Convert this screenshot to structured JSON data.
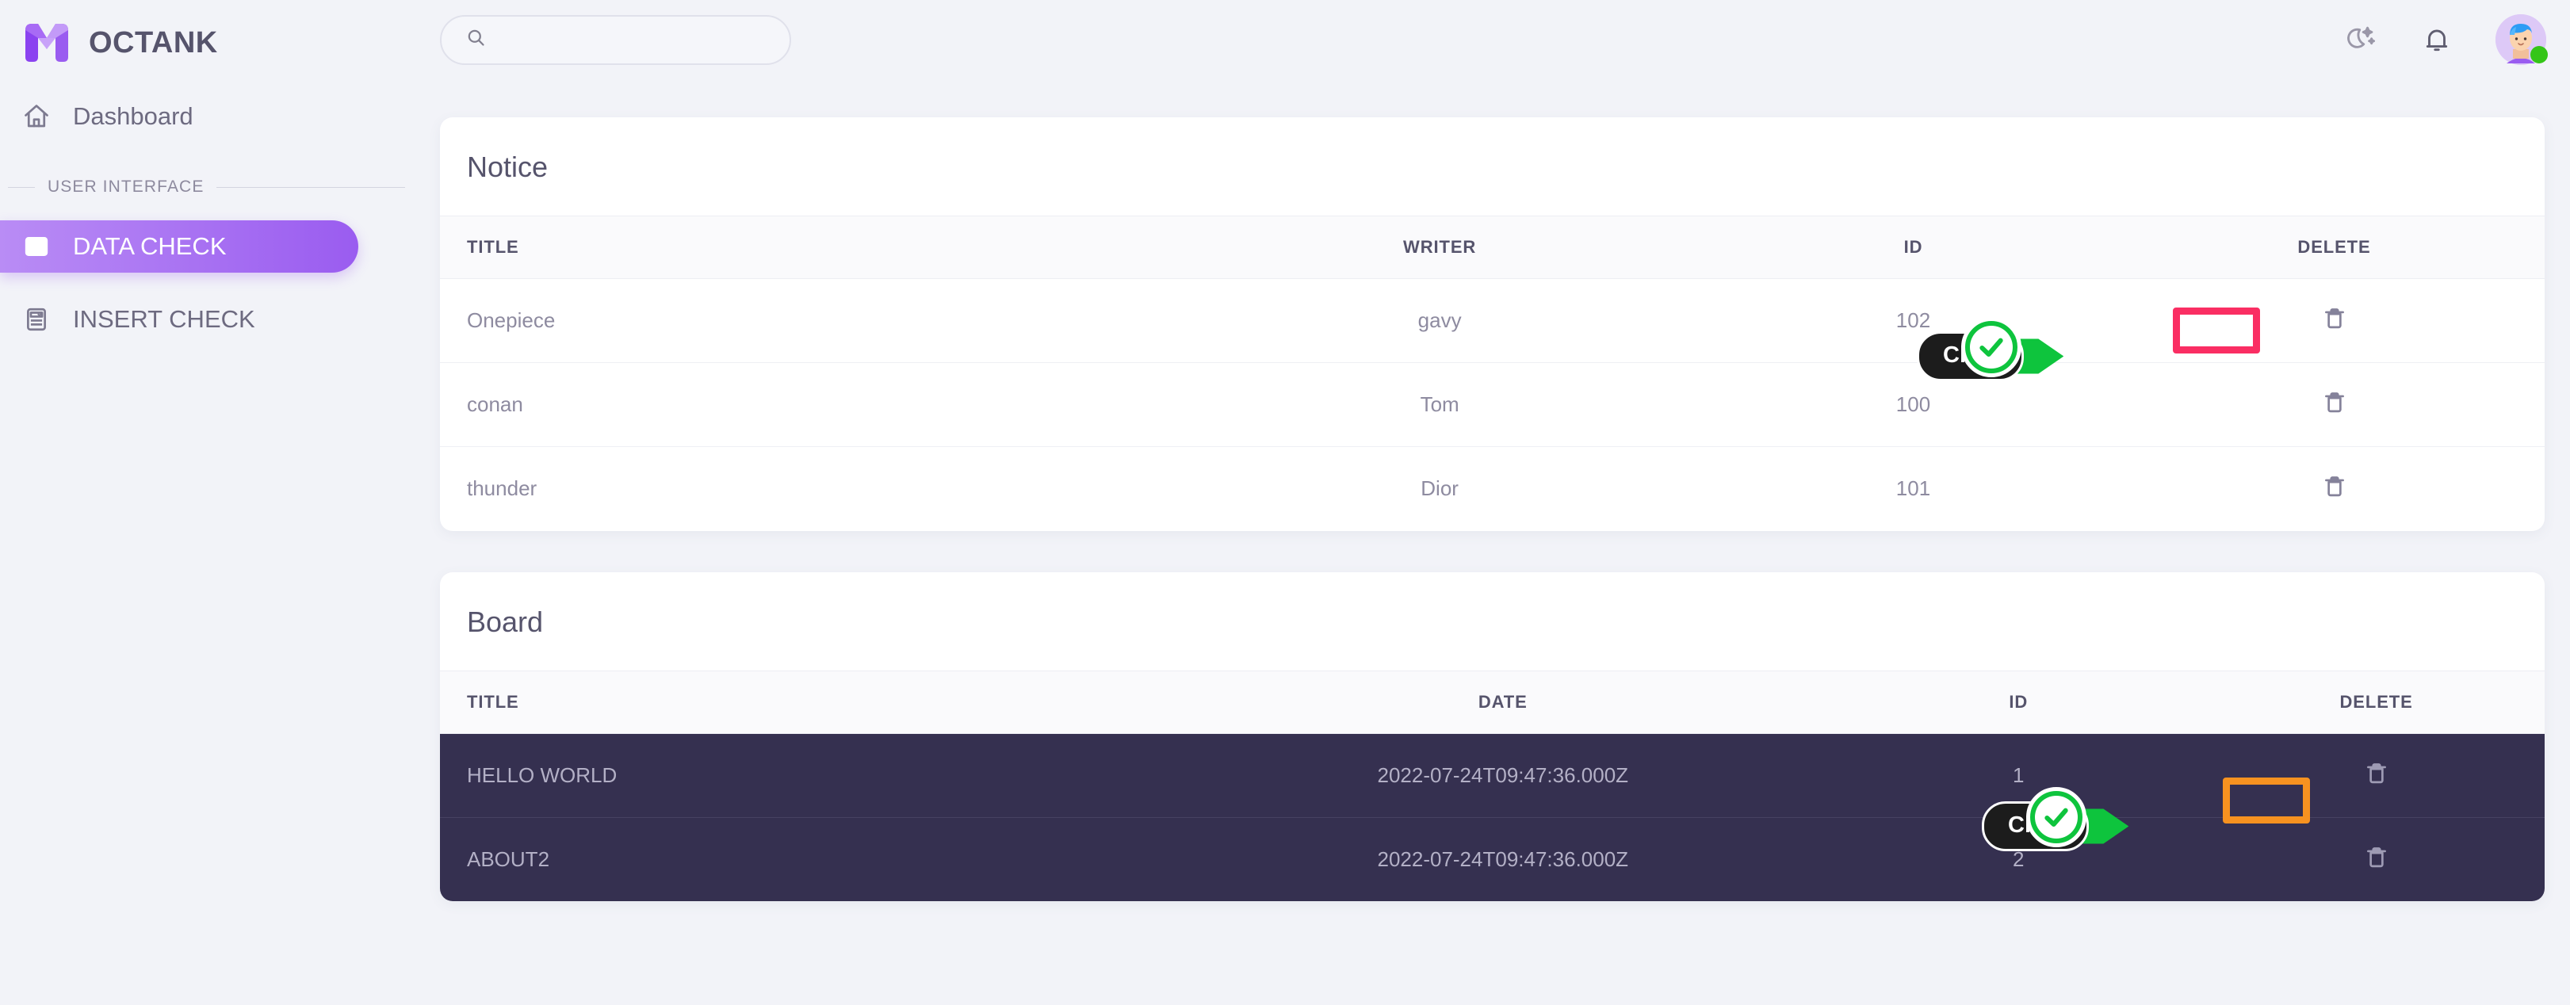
{
  "brand": {
    "name": "OCTANK",
    "logo_icon": "m-logo-icon"
  },
  "sidebar": {
    "dashboard": {
      "label": "Dashboard",
      "icon": "home-icon"
    },
    "section_label": "USER INTERFACE",
    "items": [
      {
        "label": "DATA CHECK",
        "icon": "table-grid-icon",
        "active": true
      },
      {
        "label": "INSERT CHECK",
        "icon": "form-document-icon",
        "active": false
      }
    ]
  },
  "topbar": {
    "search": {
      "value": "",
      "placeholder": "",
      "icon": "search-icon"
    },
    "dark_mode_icon": "moon-stars-icon",
    "notification_icon": "bell-icon",
    "avatar": {
      "icon": "user-avatar",
      "status": "online"
    }
  },
  "notice": {
    "title": "Notice",
    "columns": [
      "TITLE",
      "WRITER",
      "ID",
      "DELETE"
    ],
    "rows": [
      {
        "title": "Onepiece",
        "writer": "gavy",
        "id": "102",
        "delete_icon": "trash-icon"
      },
      {
        "title": "conan",
        "writer": "Tom",
        "id": "100",
        "delete_icon": "trash-icon"
      },
      {
        "title": "thunder",
        "writer": "Dior",
        "id": "101",
        "delete_icon": "trash-icon"
      }
    ]
  },
  "board": {
    "title": "Board",
    "columns": [
      "TITLE",
      "DATE",
      "ID",
      "DELETE"
    ],
    "rows": [
      {
        "title": "HELLO WORLD",
        "date": "2022-07-24T09:47:36.000Z",
        "id": "1",
        "delete_icon": "trash-icon"
      },
      {
        "title": "ABOUT2",
        "date": "2022-07-24T09:47:36.000Z",
        "id": "2",
        "delete_icon": "trash-icon"
      }
    ]
  },
  "annotations": {
    "notice_click": {
      "label": "Click",
      "highlight_color": "#fa2e63"
    },
    "board_click": {
      "label": "Click",
      "highlight_color": "#f79220"
    }
  },
  "colors": {
    "accent": "#9a5cf0",
    "page_bg": "#f2f3f8",
    "dark_row": "#353050",
    "check_green": "#0ec43d"
  }
}
